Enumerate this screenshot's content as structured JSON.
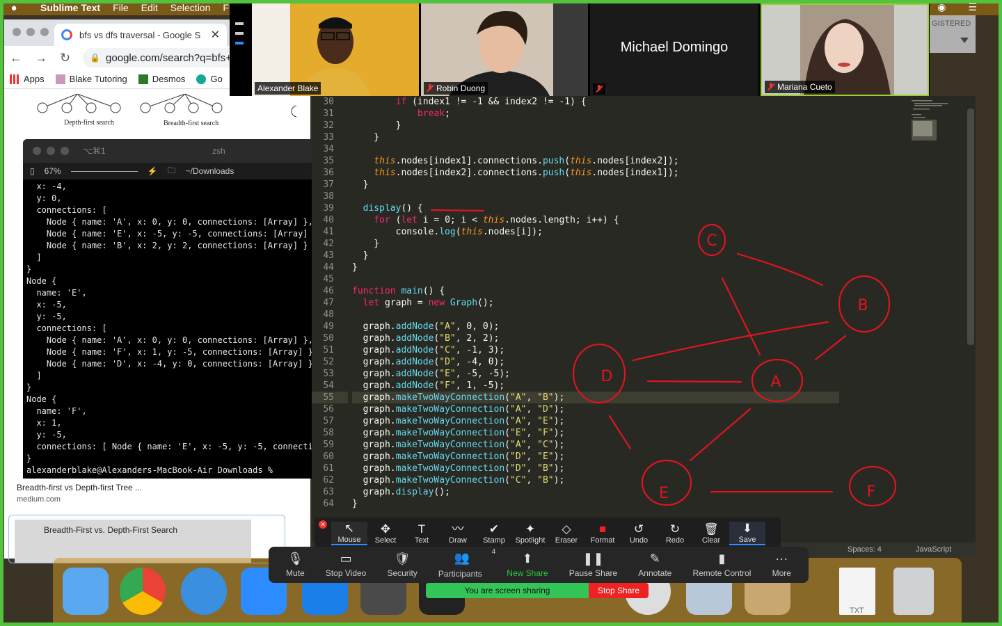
{
  "menubar": {
    "app": "Sublime Text",
    "items": [
      "File",
      "Edit",
      "Selection"
    ],
    "partial": "F"
  },
  "browser": {
    "tab_title": "bfs vs dfs traversal - Google S",
    "url": "google.com/search?q=bfs+v",
    "bookmarks": [
      "Apps",
      "Blake Tutoring",
      "Desmos",
      "Go"
    ],
    "fig_captions": [
      "Depth-first search",
      "Breadth-first search"
    ],
    "result_title": "Breadth-first vs Depth-first Tree ...",
    "result_url": "medium.com",
    "card_caption": "Breadth-First vs. Depth-First Search"
  },
  "terminal": {
    "title_shortcut": "⌥⌘1",
    "title_shell": "zsh",
    "battery": "67%",
    "folder": "~/Downloads",
    "lines": [
      "  x: -4,",
      "  y: 0,",
      "  connections: [",
      "    Node { name: 'A', x: 0, y: 0, connections: [Array] },",
      "    Node { name: 'E', x: -5, y: -5, connections: [Array] },",
      "    Node { name: 'B', x: 2, y: 2, connections: [Array] }",
      "  ]",
      "}",
      "Node {",
      "  name: 'E',",
      "  x: -5,",
      "  y: -5,",
      "  connections: [",
      "    Node { name: 'A', x: 0, y: 0, connections: [Array] },",
      "    Node { name: 'F', x: 1, y: -5, connections: [Array] },",
      "    Node { name: 'D', x: -4, y: 0, connections: [Array] }",
      "  ]",
      "}",
      "Node {",
      "  name: 'F',",
      "  x: 1,",
      "  y: -5,",
      "  connections: [ Node { name: 'E', x: -5, y: -5, connectio",
      "}",
      "alexanderblake@Alexanders-MacBook-Air Downloads % "
    ]
  },
  "editor": {
    "first_line": 30,
    "active_line": 55,
    "lines": [
      "        if (index1 != -1 && index2 != -1) {",
      "            break;",
      "        }",
      "    }",
      "",
      "    this.nodes[index1].connections.push(this.nodes[index2]);",
      "    this.nodes[index2].connections.push(this.nodes[index1]);",
      "  }",
      "",
      "  display() {",
      "    for (let i = 0; i < this.nodes.length; i++) {",
      "        console.log(this.nodes[i]);",
      "    }",
      "  }",
      "}",
      "",
      "function main() {",
      "  let graph = new Graph();",
      "",
      "  graph.addNode(\"A\", 0, 0);",
      "  graph.addNode(\"B\", 2, 2);",
      "  graph.addNode(\"C\", -1, 3);",
      "  graph.addNode(\"D\", -4, 0);",
      "  graph.addNode(\"E\", -5, -5);",
      "  graph.addNode(\"F\", 1, -5);",
      "  graph.makeTwoWayConnection(\"A\", \"B\");",
      "  graph.makeTwoWayConnection(\"A\", \"D\");",
      "  graph.makeTwoWayConnection(\"A\", \"E\");",
      "  graph.makeTwoWayConnection(\"E\", \"F\");",
      "  graph.makeTwoWayConnection(\"A\", \"C\");",
      "  graph.makeTwoWayConnection(\"D\", \"E\");",
      "  graph.makeTwoWayConnection(\"D\", \"B\");",
      "  graph.makeTwoWayConnection(\"C\", \"B\");",
      "  graph.display();",
      "}"
    ],
    "spaces": "Spaces: 4",
    "language": "JavaScript"
  },
  "participants": [
    {
      "name": "Alexander Blake",
      "muted": false,
      "bg": "#d9a12b"
    },
    {
      "name": "Robin Duong",
      "muted": true,
      "bg": "#c9a887"
    },
    {
      "name": "Michael Domingo",
      "muted": true,
      "bg": "#1a1a1a"
    },
    {
      "name": "Mariana Cueto",
      "muted": true,
      "bg": "#9c8a7c"
    }
  ],
  "registered_fragment": "GISTERED",
  "annotate_tools": [
    "Mouse",
    "Select",
    "Text",
    "Draw",
    "Stamp",
    "Spotlight",
    "Eraser",
    "Format",
    "Undo",
    "Redo",
    "Clear",
    "Save"
  ],
  "annotate_icons": [
    "↖",
    "✥",
    "T",
    "〰",
    "✔",
    "✦",
    "◇",
    "■",
    "↺",
    "↻",
    "🗑",
    "⬇"
  ],
  "share_toolbar": {
    "buttons": [
      "Mute",
      "Stop Video",
      "Security",
      "Participants",
      "New Share",
      "Pause Share",
      "Annotate",
      "Remote Control",
      "More"
    ],
    "icons": [
      "🎙",
      "▭",
      "🛡",
      "👥",
      "⬆",
      "❚❚",
      "✎",
      "▮",
      "···"
    ],
    "participant_count": "4",
    "sharing_notice": "You are screen sharing",
    "stop_share": "Stop Share"
  },
  "annotation_nodes": [
    "C",
    "B",
    "D",
    "A",
    "E",
    "F"
  ],
  "dock": {
    "txt_label": "TXT"
  },
  "colors": {
    "annotation": "#e0141e",
    "zoom_green": "#53c23c",
    "keyword": "#f92672",
    "string": "#e6db74",
    "number": "#ae81ff",
    "func": "#66d9ef"
  }
}
